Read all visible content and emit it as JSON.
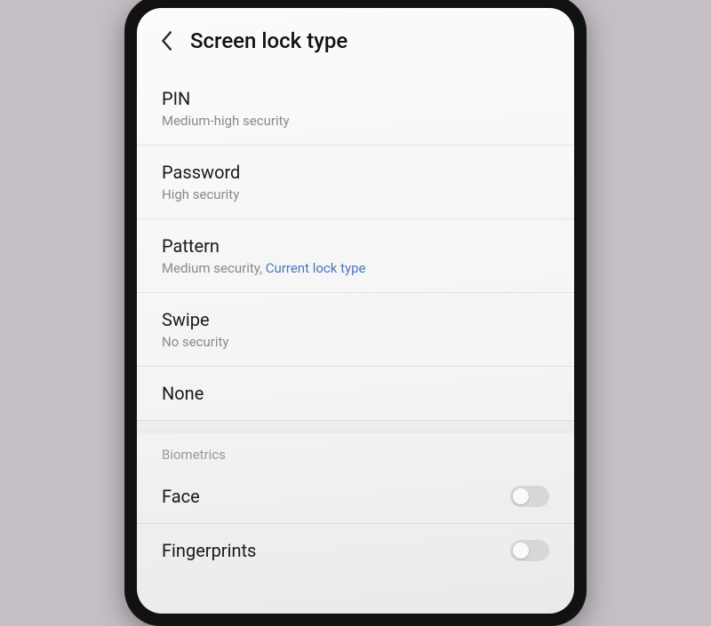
{
  "header": {
    "title": "Screen lock type"
  },
  "lock_types": [
    {
      "title": "PIN",
      "sub": "Medium-high security",
      "current": false
    },
    {
      "title": "Password",
      "sub": "High security",
      "current": false
    },
    {
      "title": "Pattern",
      "sub": "Medium security,",
      "current": true,
      "current_label": "Current lock type"
    },
    {
      "title": "Swipe",
      "sub": "No security",
      "current": false
    },
    {
      "title": "None",
      "sub": "",
      "current": false
    }
  ],
  "biometrics": {
    "section_label": "Biometrics",
    "items": [
      {
        "title": "Face",
        "enabled": false
      },
      {
        "title": "Fingerprints",
        "enabled": false
      }
    ]
  }
}
